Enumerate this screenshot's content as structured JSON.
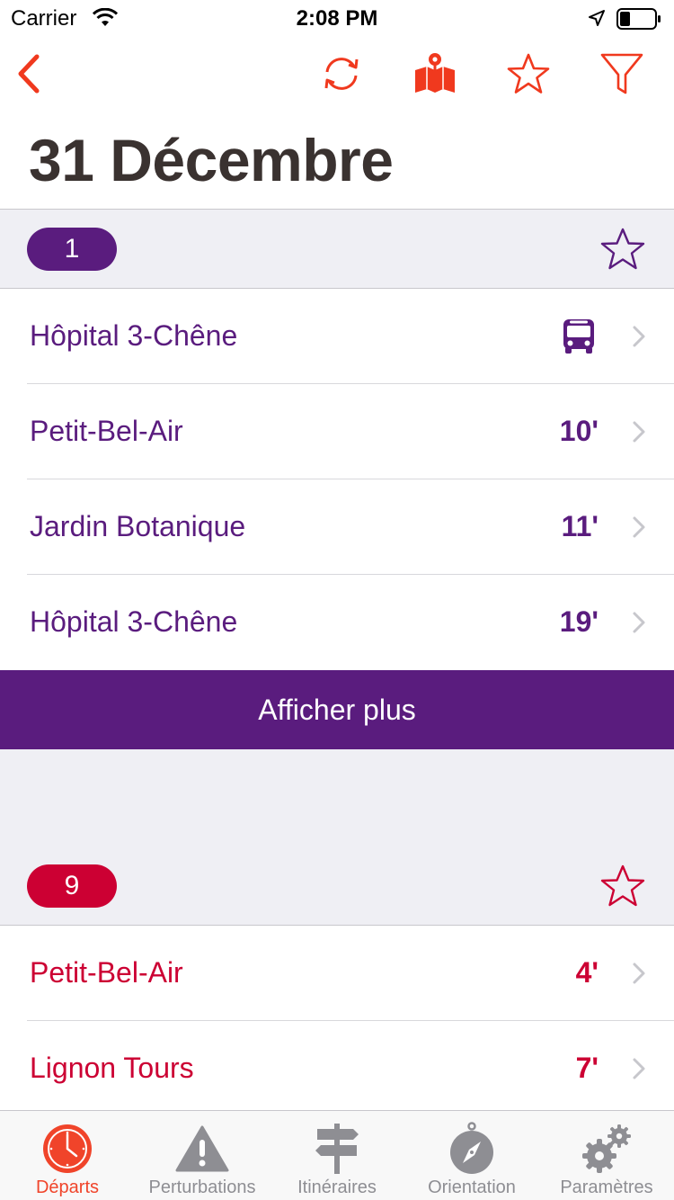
{
  "status": {
    "carrier": "Carrier",
    "time": "2:08 PM"
  },
  "colors": {
    "accent": "#f0391e",
    "line1": "#5a1c7e",
    "line9": "#cc0033",
    "title": "#3a3230",
    "inactive": "#8e8e93"
  },
  "nav": {
    "icons": [
      "back-icon",
      "refresh-icon",
      "map-icon",
      "star-icon",
      "filter-icon"
    ]
  },
  "title": "31 Décembre",
  "sections": [
    {
      "line": "1",
      "rows": [
        {
          "name": "Hôpital 3-Chêne",
          "minutes": "",
          "icon": "bus-icon"
        },
        {
          "name": "Petit-Bel-Air",
          "minutes": "10'"
        },
        {
          "name": "Jardin Botanique",
          "minutes": "11'"
        },
        {
          "name": "Hôpital 3-Chêne",
          "minutes": "19'"
        }
      ],
      "more_label": "Afficher plus"
    },
    {
      "line": "9",
      "rows": [
        {
          "name": "Petit-Bel-Air",
          "minutes": "4'"
        },
        {
          "name": "Lignon Tours",
          "minutes": "7'"
        }
      ]
    }
  ],
  "tabs": [
    {
      "label": "Départs",
      "icon": "clock-icon",
      "active": true
    },
    {
      "label": "Perturbations",
      "icon": "warning-icon",
      "active": false
    },
    {
      "label": "Itinéraires",
      "icon": "signpost-icon",
      "active": false
    },
    {
      "label": "Orientation",
      "icon": "compass-icon",
      "active": false
    },
    {
      "label": "Paramètres",
      "icon": "gears-icon",
      "active": false
    }
  ]
}
